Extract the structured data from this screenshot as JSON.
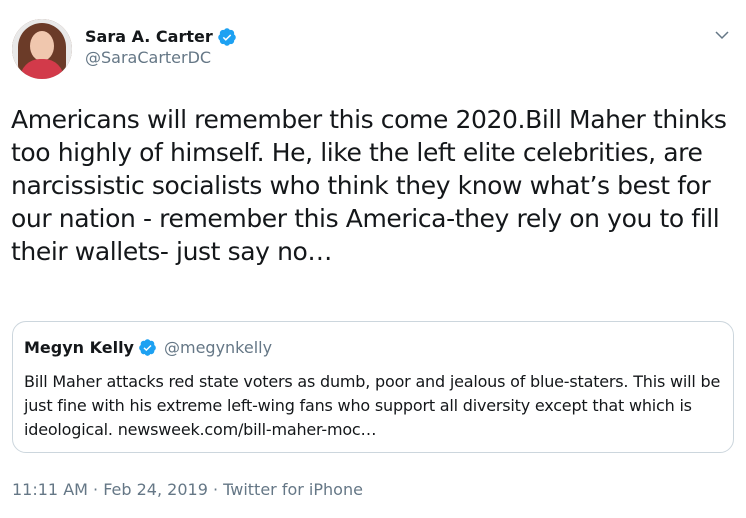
{
  "author": {
    "display_name": "Sara A. Carter",
    "handle": "@SaraCarterDC"
  },
  "tweet": {
    "text": "Americans will remember this come 2020.Bill Maher thinks too highly of himself. He, like the left elite celebrities, are narcissistic socialists who think they know what’s best for our nation - remember this America-they rely on you to fill their wallets- just say no…"
  },
  "quoted": {
    "display_name": "Megyn Kelly",
    "handle": "@megynkelly",
    "text": "Bill Maher attacks red state voters as dumb, poor and jealous of blue-staters. This will be just fine with his extreme left-wing fans who support all diversity except that which is ideological. newsweek.com/bill-maher-moc…"
  },
  "meta": {
    "line": "11:11 AM · Feb 24, 2019 · Twitter for iPhone"
  },
  "icons": {
    "verified": "verified-badge-icon",
    "menu": "chevron-down-icon"
  },
  "colors": {
    "verified_blue": "#1da1f2",
    "secondary_text": "#657786",
    "border": "#ccd6dd"
  }
}
